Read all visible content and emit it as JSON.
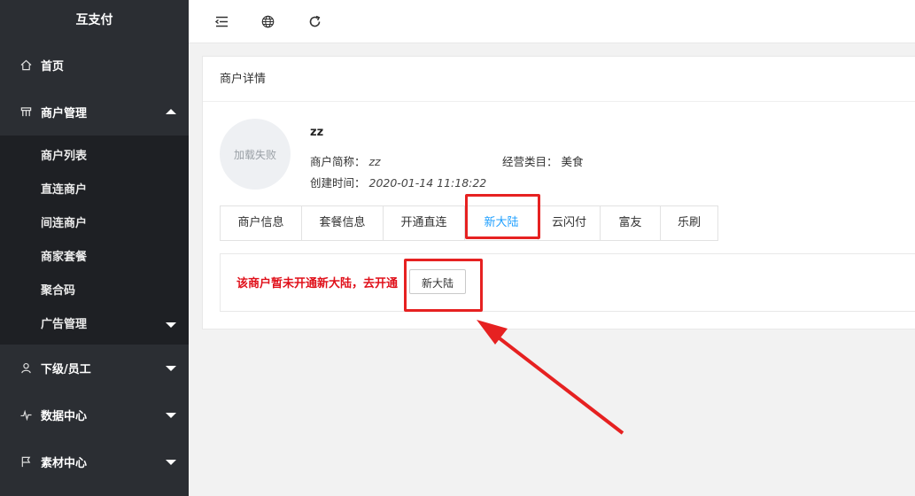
{
  "sidebar": {
    "logo": "互支付",
    "items": [
      {
        "label": "首页",
        "icon": "home-icon"
      },
      {
        "label": "商户管理",
        "icon": "store-icon"
      },
      {
        "label": "下级/员工",
        "icon": "user-icon"
      },
      {
        "label": "数据中心",
        "icon": "pulse-icon"
      },
      {
        "label": "素材中心",
        "icon": "flag-icon"
      }
    ],
    "submenu": [
      "商户列表",
      "直连商户",
      "间连商户",
      "商家套餐",
      "聚合码",
      "广告管理"
    ]
  },
  "topbar": {
    "icons": [
      "menu-fold-icon",
      "globe-icon",
      "refresh-icon"
    ]
  },
  "card": {
    "title": "商户详情",
    "avatar_text": "加载失败",
    "merchant": {
      "name": "zz",
      "short_label": "商户简称：",
      "short_value": "zz",
      "category_label": "经营类目：",
      "category_value": "美食",
      "created_label": "创建时间：",
      "created_value": "2020-01-14 11:18:22"
    },
    "tabs": [
      "商户信息",
      "套餐信息",
      "开通直连",
      "新大陆",
      "云闪付",
      "富友",
      "乐刷"
    ],
    "active_tab": "新大陆",
    "notice": "该商户暂未开通新大陆，去开通",
    "open_button": "新大陆"
  },
  "colors": {
    "accent": "#1e9fff",
    "sidebar": "#2b2e33",
    "warning": "#e0101a",
    "annotation": "#e62121"
  }
}
